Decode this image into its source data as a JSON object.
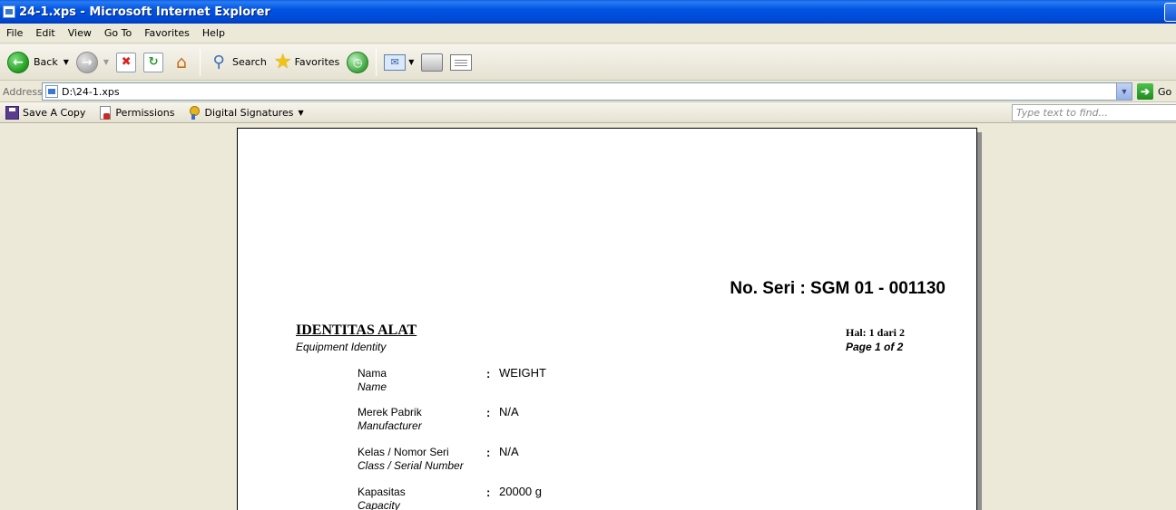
{
  "window": {
    "title": "24-1.xps - Microsoft Internet Explorer"
  },
  "menu": [
    "File",
    "Edit",
    "View",
    "Go To",
    "Favorites",
    "Help"
  ],
  "toolbar": {
    "back": "Back",
    "search": "Search",
    "favorites": "Favorites"
  },
  "address": {
    "label": "Address",
    "value": "D:\\24-1.xps",
    "go": "Go"
  },
  "xps": {
    "save": "Save A Copy",
    "permissions": "Permissions",
    "signatures": "Digital Signatures",
    "find_placeholder": "Type text to find..."
  },
  "document": {
    "serial": "No. Seri : SGM 01 - 001130",
    "section_title": "IDENTITAS ALAT",
    "section_subtitle": "Equipment Identity",
    "page_id": "Hal: 1 dari 2",
    "page_en": "Page 1 of 2",
    "fields": [
      {
        "label": "Nama",
        "label_en": "Name",
        "value": "WEIGHT"
      },
      {
        "label": "Merek Pabrik",
        "label_en": "Manufacturer",
        "value": "N/A"
      },
      {
        "label": "Kelas / Nomor Seri",
        "label_en": "Class / Serial Number",
        "value": "N/A"
      },
      {
        "label": "Kapasitas",
        "label_en": "Capacity",
        "value": "20000 g"
      }
    ]
  }
}
